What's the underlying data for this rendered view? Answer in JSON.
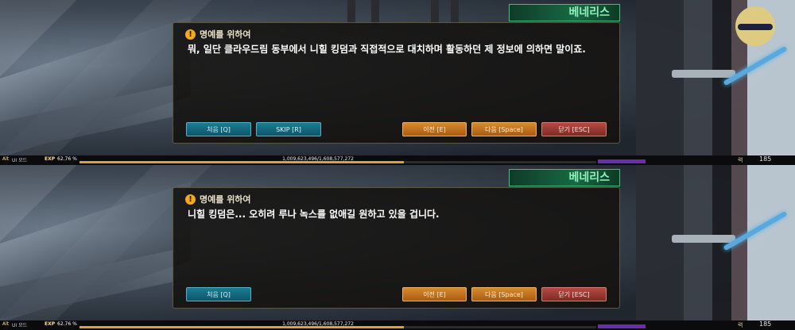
{
  "panels": [
    {
      "npc_name": "베네리스",
      "dialog": {
        "title": "명예를 위하여",
        "text": "뭐, 일단 클라우드림 동부에서 니힐 킹덤과 직접적으로 대치하며 활동하던 제 정보에 의하면 말이죠."
      },
      "buttons": {
        "first": "처음 [Q]",
        "skip": "SKIP [R]",
        "prev": "이전 [E]",
        "next": "다음 [Space]",
        "close": "닫기 [ESC]"
      }
    },
    {
      "npc_name": "베네리스",
      "dialog": {
        "title": "명예를 위하여",
        "text": "니힐 킹덤은... 오히려 루나 녹스를 없애길 원하고 있을 겁니다."
      },
      "buttons": {
        "first": "처음 [Q]",
        "prev": "이전 [E]",
        "next": "다음 [Space]",
        "close": "닫기 [ESC]"
      }
    }
  ],
  "hud": {
    "alt_label": "Alt",
    "ui_mode_label": "UI 모드",
    "exp_label": "EXP",
    "exp_percent": "62.76 %",
    "exp_fraction": 0.6276,
    "exp_value": "1,009,623,496/1,608,577,272",
    "level_label": "력",
    "level_value": "185"
  },
  "colors": {
    "teal_button": "#1b7c93",
    "orange_button": "#d8892f",
    "red_button": "#b54a42",
    "npc_title": "#176a44",
    "exp_bar": "#d6a72e"
  },
  "icons": {
    "dialog_title": "exclamation-icon"
  }
}
